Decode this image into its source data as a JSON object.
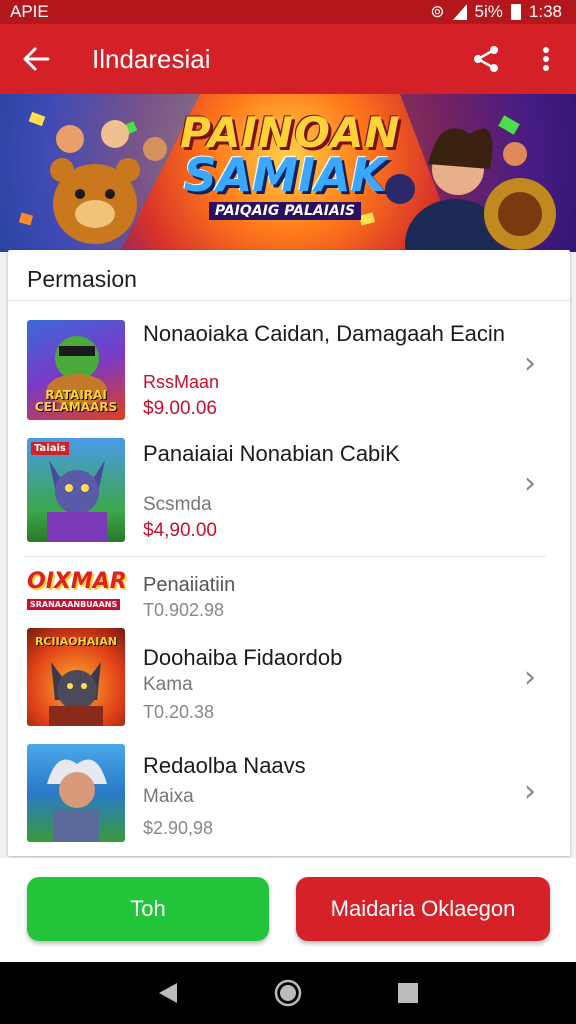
{
  "status": {
    "carrier": "APIE",
    "signal": "5i%",
    "time": "1:38"
  },
  "appbar": {
    "title": "Ilndaresiai",
    "back_icon": "arrow-left-icon",
    "share_icon": "share-icon",
    "menu_icon": "more-vert-icon"
  },
  "banner": {
    "line1": "PAINOAN",
    "line2": "SAMIAK",
    "line3": "PAIQAIG PALAIAIS"
  },
  "section": {
    "title": "Permasion"
  },
  "items": [
    {
      "title": "Nonaoiaka Caidan, Damagaah Eacin",
      "subtitle": "RssMaan",
      "price": "$9.00.06",
      "thumb_caption": "RATAIRAI CELAMAARS"
    },
    {
      "title": "Panaiaiai Nonabian CabiK",
      "subtitle": "Scsmda",
      "price": "$4,90.00",
      "thumb_tag": "Taiais"
    },
    {
      "title": "Penaiiatiin",
      "price": "T0.902.98",
      "logo_text": "OIXMAR",
      "logo_sub": "SRANAAANBUAANS"
    },
    {
      "title": "Doohaiba Fidaordob",
      "subtitle": "Kama",
      "price": "T0.20.38",
      "thumb_caption": "RCIIAOHAIAN"
    },
    {
      "title": "Redaolba Naavs",
      "subtitle": "Maixa",
      "price": "$2.90,98"
    }
  ],
  "buttons": {
    "primary": "Toh",
    "secondary": "Maidaria Oklaegon"
  },
  "colors": {
    "appbar": "#d42128",
    "status": "#b3161b",
    "price_red": "#c8102e",
    "green": "#22c43a",
    "red_button": "#d62128"
  }
}
